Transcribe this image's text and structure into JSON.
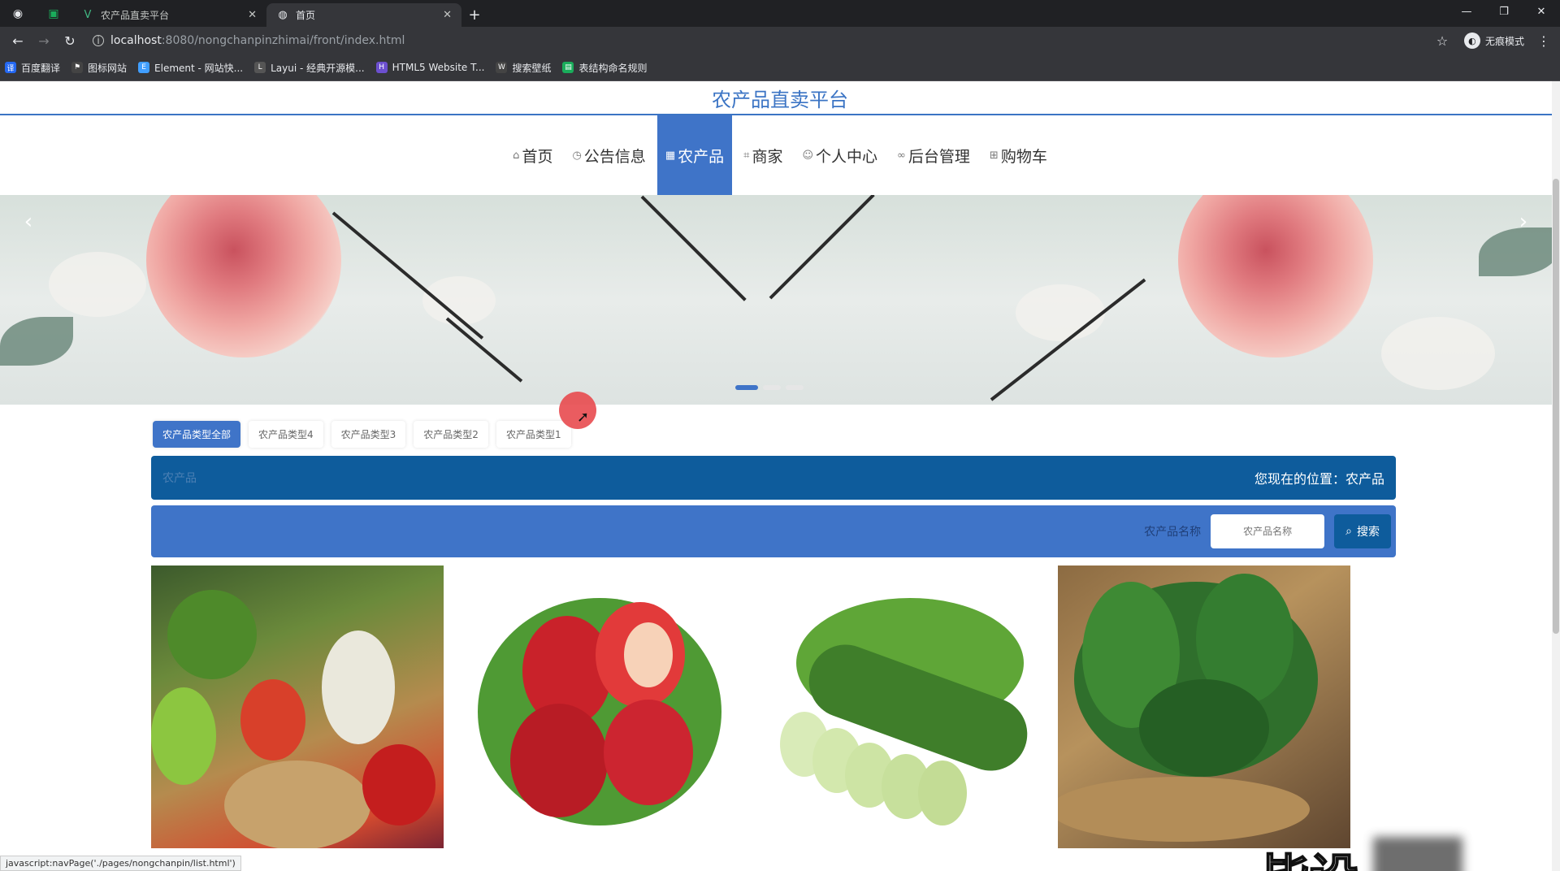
{
  "browser": {
    "tabs": [
      {
        "title": "农产品直卖平台",
        "icon": "vue-logo-icon",
        "active": false
      },
      {
        "title": "首页",
        "icon": "globe-icon",
        "active": true
      }
    ],
    "url_host": "localhost",
    "url_path": ":8080/nongchanpinzhimai/front/index.html",
    "profile_label": "无痕模式",
    "bookmarks": [
      {
        "label": "百度翻译",
        "color": "#2468f2"
      },
      {
        "label": "图标网站",
        "color": "#444"
      },
      {
        "label": "Element - 网站快...",
        "color": "#409eff"
      },
      {
        "label": "Layui - 经典开源模...",
        "color": "#555"
      },
      {
        "label": "HTML5 Website T...",
        "color": "#6c4fcf"
      },
      {
        "label": "搜索壁纸",
        "color": "#444"
      },
      {
        "label": "表结构命名规则",
        "color": "#1aad5b"
      }
    ]
  },
  "site": {
    "title": "农产品直卖平台",
    "nav": [
      {
        "label": "首页",
        "icon": "home-icon",
        "active": false
      },
      {
        "label": "公告信息",
        "icon": "clock-icon",
        "active": false
      },
      {
        "label": "农产品",
        "icon": "grid-icon",
        "active": true
      },
      {
        "label": "商家",
        "icon": "shop-icon",
        "active": false
      },
      {
        "label": "个人中心",
        "icon": "user-icon",
        "active": false
      },
      {
        "label": "后台管理",
        "icon": "link-icon",
        "active": false
      },
      {
        "label": "购物车",
        "icon": "cart-icon",
        "active": false
      }
    ],
    "carousel": {
      "slide_count": 3,
      "active_index": 0
    }
  },
  "categories": [
    {
      "label": "农产品类型全部",
      "active": true
    },
    {
      "label": "农产品类型4",
      "active": false
    },
    {
      "label": "农产品类型3",
      "active": false
    },
    {
      "label": "农产品类型2",
      "active": false
    },
    {
      "label": "农产品类型1",
      "active": false
    }
  ],
  "breadcrumb": {
    "left": "农产品",
    "right": "您现在的位置：农产品"
  },
  "search": {
    "label": "农产品名称",
    "placeholder": "农产品名称",
    "button": "搜索"
  },
  "products": [
    {
      "name": "vegetable-basket"
    },
    {
      "name": "strawberries"
    },
    {
      "name": "cucumbers"
    },
    {
      "name": "spinach"
    }
  ],
  "watermark": "毕设",
  "status_url": "javascript:navPage('./pages/nongchanpin/list.html')"
}
